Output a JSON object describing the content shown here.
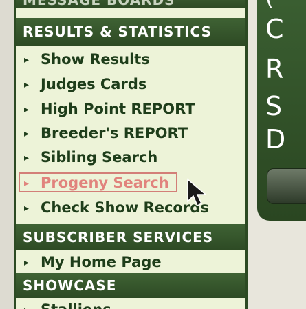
{
  "nav": {
    "top_header": "MESSAGE BOARDS",
    "results_header": "RESULTS & STATISTICS",
    "results_items": [
      {
        "label": "Show Results"
      },
      {
        "label": "Judges Cards"
      },
      {
        "label": "High Point REPORT"
      },
      {
        "label": "Breeder's REPORT"
      },
      {
        "label": "Sibling Search"
      },
      {
        "label": "Progeny Search",
        "state": "active"
      },
      {
        "label": "Check Show Records"
      }
    ],
    "subscriber_header": "SUBSCRIBER SERVICES",
    "subscriber_items": [
      {
        "label": "My Home Page"
      }
    ],
    "showcase_header": "SHOWCASE",
    "showcase_items": [
      {
        "label": "Stallions"
      }
    ]
  },
  "right_panel": {
    "lines": [
      "C",
      "R",
      "S",
      "D"
    ],
    "top_fragment": "("
  },
  "colors": {
    "header_green": "#2d4a24",
    "menu_text": "#1e3d1a",
    "menu_bg": "#edf3d8",
    "active_item": "#e1837d"
  },
  "icons": {
    "item_bullet": "triangle-right-icon",
    "pointer": "mouse-cursor-icon"
  }
}
